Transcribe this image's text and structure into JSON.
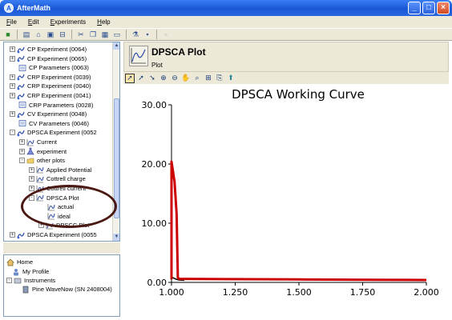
{
  "window": {
    "title": "AfterMath",
    "brand_color": "#1957d6"
  },
  "menu": [
    {
      "label": "File",
      "key": "F",
      "rest": "ile"
    },
    {
      "label": "Edit",
      "key": "E",
      "rest": "dit"
    },
    {
      "label": "Experiments",
      "key": "E",
      "rest": "xperiments"
    },
    {
      "label": "Help",
      "key": "H",
      "rest": "elp"
    }
  ],
  "tree": {
    "items": [
      {
        "label": "CP Experiment (0064)",
        "icon": "experiment-icon",
        "expander": "+"
      },
      {
        "label": "CP Experiment (0065)",
        "icon": "experiment-icon",
        "expander": "+"
      },
      {
        "label": "CP Parameters (0063)",
        "icon": "parameters-icon",
        "expander": ""
      },
      {
        "label": "CRP Experiment (0039)",
        "icon": "experiment-icon",
        "expander": "+"
      },
      {
        "label": "CRP Experiment (0040)",
        "icon": "experiment-icon",
        "expander": "+"
      },
      {
        "label": "CRP Experiment (0041)",
        "icon": "experiment-icon",
        "expander": "+"
      },
      {
        "label": "CRP Parameters (0028)",
        "icon": "parameters-icon",
        "expander": ""
      },
      {
        "label": "CV Experiment (0048)",
        "icon": "experiment-icon",
        "expander": "+"
      },
      {
        "label": "CV Parameters (0046)",
        "icon": "parameters-icon",
        "expander": ""
      },
      {
        "label": "DPSCA Experiment (0052",
        "icon": "experiment-icon",
        "expander": "-"
      },
      {
        "label": "Current",
        "icon": "plot-icon",
        "expander": "+"
      },
      {
        "label": "experiment",
        "icon": "flask-icon",
        "expander": "+"
      },
      {
        "label": "other plots",
        "icon": "folder-icon",
        "expander": "-"
      },
      {
        "label": "Applied Potential",
        "icon": "plot-icon",
        "expander": "+"
      },
      {
        "label": "Cottrell charge",
        "icon": "plot-icon",
        "expander": "+"
      },
      {
        "label": "Cottrell current",
        "icon": "plot-icon",
        "expander": "+"
      },
      {
        "label": "DPSCA Plot",
        "icon": "plot-icon",
        "expander": "-"
      },
      {
        "label": "actual",
        "icon": "plot-icon",
        "expander": ""
      },
      {
        "label": "ideal",
        "icon": "plot-icon",
        "expander": ""
      },
      {
        "label": "DPSCC Plot",
        "icon": "plot-icon",
        "expander": "+"
      },
      {
        "label": "DPSCA Experiment (0055",
        "icon": "experiment-icon",
        "expander": "+"
      }
    ]
  },
  "nav": {
    "items": [
      {
        "label": "Home",
        "icon": "home-icon"
      },
      {
        "label": "My Profile",
        "icon": "profile-icon"
      },
      {
        "label": "Instruments",
        "icon": "instruments-icon"
      },
      {
        "label": "Pine WaveNow (SN 2408004)",
        "icon": "instrument-icon"
      }
    ]
  },
  "plot_header": {
    "title": "DPSCA Plot",
    "subtitle": "Plot"
  },
  "chart_data": {
    "type": "line",
    "title": "DPSCA Working Curve",
    "xlabel": "",
    "ylabel": "",
    "xlim": [
      1.0,
      2.0
    ],
    "ylim": [
      0.0,
      30.0
    ],
    "x_ticks": [
      "1.000",
      "1.250",
      "1.500",
      "1.750",
      "2.000"
    ],
    "y_ticks": [
      "0.00",
      "10.00",
      "20.00",
      "30.00"
    ],
    "grid": false,
    "series": [
      {
        "color": "#000000",
        "x": [
          1.0,
          1.005,
          1.01,
          1.02,
          1.03,
          1.05
        ],
        "y": [
          0.6,
          0.8,
          0.7,
          0.5,
          0.4,
          0.35
        ]
      },
      {
        "color": "#cc0000",
        "x": [
          1.0,
          1.0,
          1.012,
          1.02,
          1.025,
          1.03,
          1.05,
          1.2,
          1.5,
          1.8,
          2.0
        ],
        "y": [
          0.5,
          20.4,
          17.0,
          11.5,
          0.8,
          0.6,
          0.6,
          0.55,
          0.5,
          0.45,
          0.4
        ]
      }
    ]
  }
}
